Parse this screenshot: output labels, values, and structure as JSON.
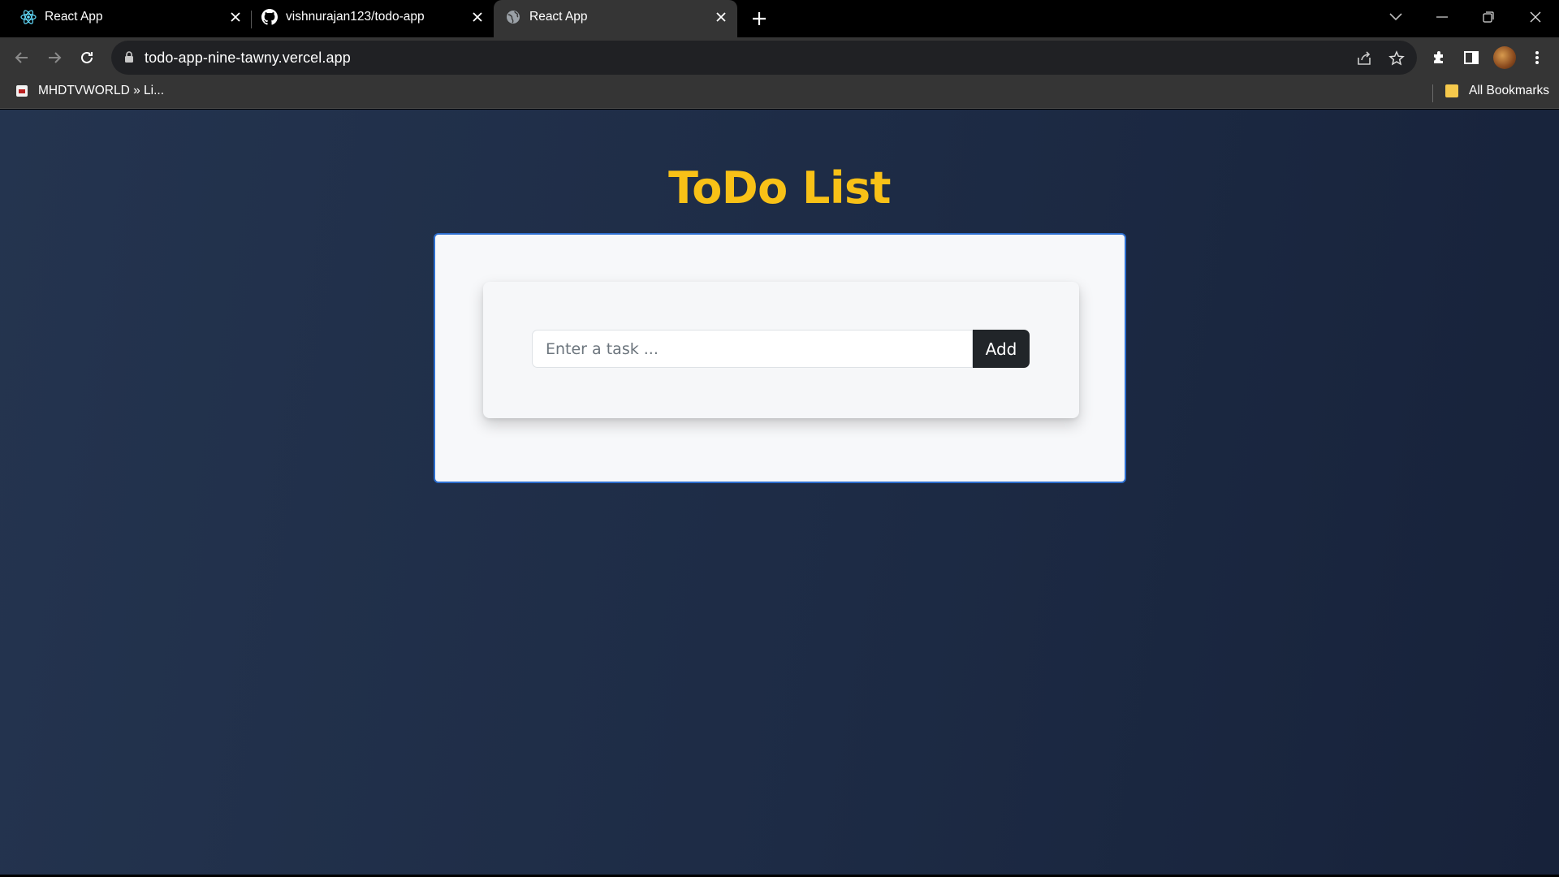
{
  "browser": {
    "tabs": [
      {
        "title": "React App",
        "icon": "react-icon",
        "active": false
      },
      {
        "title": "vishnurajan123/todo-app",
        "icon": "github-icon",
        "active": false
      },
      {
        "title": "React App",
        "icon": "globe-icon",
        "active": true
      }
    ],
    "url": "todo-app-nine-tawny.vercel.app",
    "bookmarks": {
      "items": [
        {
          "label": "MHDTVWORLD » Li..."
        }
      ],
      "all_bookmarks_label": "All Bookmarks"
    }
  },
  "app": {
    "title": "ToDo List",
    "title_color": "#f8c117",
    "input_placeholder": "Enter a task ...",
    "input_value": "",
    "add_label": "Add"
  }
}
